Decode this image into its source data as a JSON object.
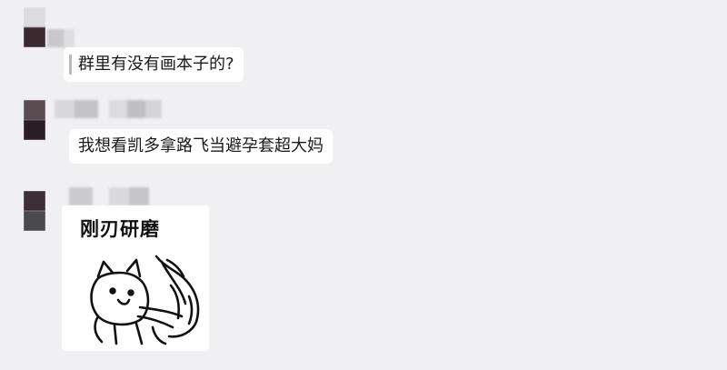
{
  "messages": [
    {
      "text": "群里有没有画本子的?"
    },
    {
      "text": "我想看凯多拿路飞当避孕套超大妈"
    }
  ],
  "sticker": {
    "caption": "刚刃研磨",
    "icon": "cartoon-cat-sticker"
  },
  "colors": {
    "background": "#f0f0f2",
    "bubble": "#ffffff",
    "text": "#1a1a1a",
    "quote_bar": "#b9b9b9"
  }
}
